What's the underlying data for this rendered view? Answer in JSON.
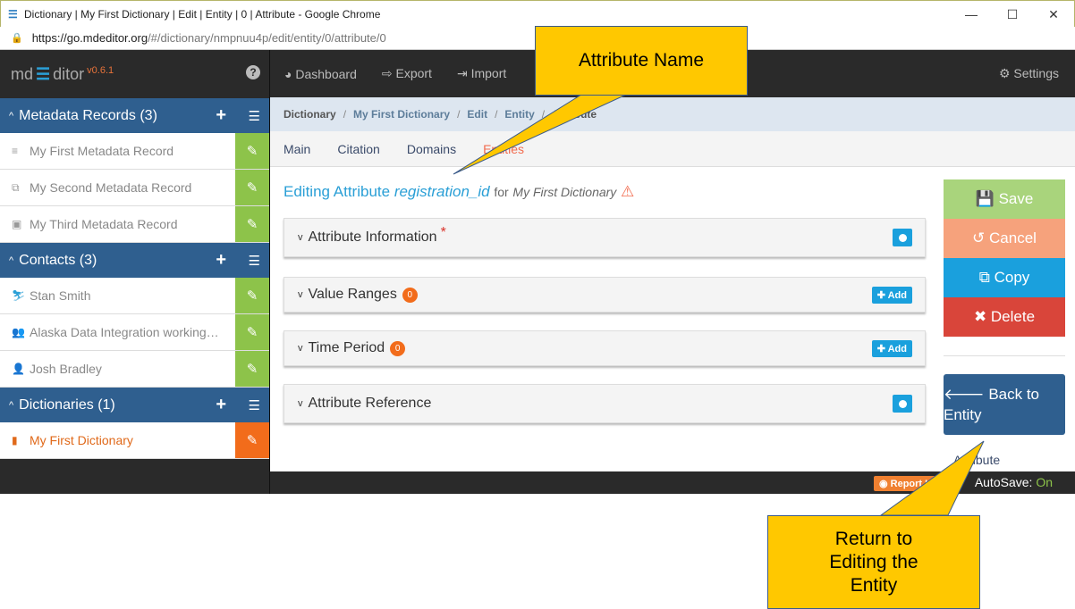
{
  "window": {
    "title": "Dictionary | My First Dictionary | Edit | Entity | 0 | Attribute - Google Chrome",
    "url_host": "https://go.mdeditor.org",
    "url_path": "/#/dictionary/nmpnuu4p/edit/entity/0/attribute/0"
  },
  "brand": {
    "md": "md",
    "ditor": "ditor",
    "version": "v0.6.1"
  },
  "topnav": {
    "dashboard": "Dashboard",
    "export": "Export",
    "import": "Import",
    "settings": "Settings"
  },
  "sidebar": {
    "metadata": {
      "label": "Metadata Records (3)",
      "items": [
        "My First Metadata Record",
        "My Second Metadata Record",
        "My Third Metadata Record"
      ]
    },
    "contacts": {
      "label": "Contacts (3)",
      "items": [
        "Stan Smith",
        "Alaska Data Integration working…",
        "Josh Bradley"
      ]
    },
    "dictionaries": {
      "label": "Dictionaries (1)",
      "items": [
        "My First Dictionary"
      ]
    }
  },
  "breadcrumb": [
    "Dictionary",
    "My First Dictionary",
    "Edit",
    "Entity",
    "Attribute"
  ],
  "tabs": [
    "Main",
    "Citation",
    "Domains",
    "Entities"
  ],
  "heading": {
    "prefix": "Editing Attribute",
    "name": "registration_id",
    "for": "for",
    "dictionary": "My First Dictionary"
  },
  "panels": [
    {
      "label": "Attribute Information"
    },
    {
      "label": "Value Ranges",
      "count": "0",
      "button": "Add"
    },
    {
      "label": "Time Period",
      "count": "0",
      "button": "Add"
    },
    {
      "label": "Attribute Reference"
    }
  ],
  "actions": {
    "save": "Save",
    "cancel": "Cancel",
    "copy": "Copy",
    "delete": "Delete",
    "back": "Back to Entity",
    "under_label": "Attribute"
  },
  "footer": {
    "report": "Report Issue",
    "autosave_label": "AutoSave:",
    "autosave_value": "On"
  },
  "callouts": {
    "attribute_name": "Attribute Name",
    "return": "Return to Editing the Entity"
  }
}
